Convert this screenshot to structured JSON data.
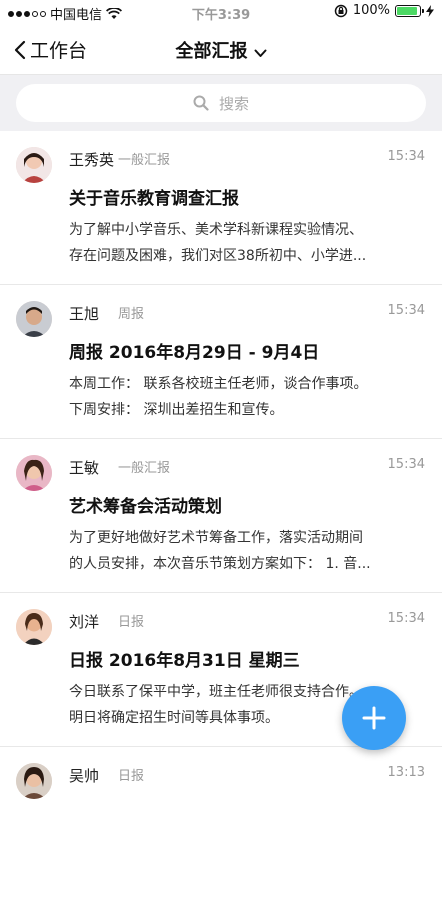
{
  "status_bar": {
    "carrier": "中国电信",
    "time": "下午3:39",
    "battery": "100%"
  },
  "nav": {
    "back_label": "工作台",
    "title": "全部汇报"
  },
  "search": {
    "placeholder": "搜索"
  },
  "reports": [
    {
      "name": "王秀英",
      "type": "一般汇报",
      "time": "15:34",
      "title": "关于音乐教育调查汇报",
      "lines": [
        "为了解中小学音乐、美术学科新课程实验情况、",
        "存在问题及困难，我们对区38所初中、小学进..."
      ]
    },
    {
      "name": "王旭",
      "type": "周报",
      "time": "15:34",
      "title": "周报 2016年8月29日 - 9月4日",
      "lines": [
        "本周工作：  联系各校班主任老师，谈合作事项。",
        "下周安排：  深圳出差招生和宣传。"
      ]
    },
    {
      "name": "王敏",
      "type": "一般汇报",
      "time": "15:34",
      "title": "艺术筹备会活动策划",
      "lines": [
        "为了更好地做好艺术节筹备工作，落实活动期间",
        "的人员安排，本次音乐节策划方案如下：  1. 音..."
      ]
    },
    {
      "name": "刘洋",
      "type": "日报",
      "time": "15:34",
      "title": "日报 2016年8月31日 星期三",
      "lines": [
        "今日联系了保平中学，班主任老师很支持合作。",
        "明日将确定招生时间等具体事项。"
      ]
    },
    {
      "name": "吴帅",
      "type": "日报",
      "time": "13:13",
      "title": "",
      "lines": []
    }
  ],
  "colors": {
    "accent": "#3a9ff5",
    "battery": "#4cd964"
  }
}
